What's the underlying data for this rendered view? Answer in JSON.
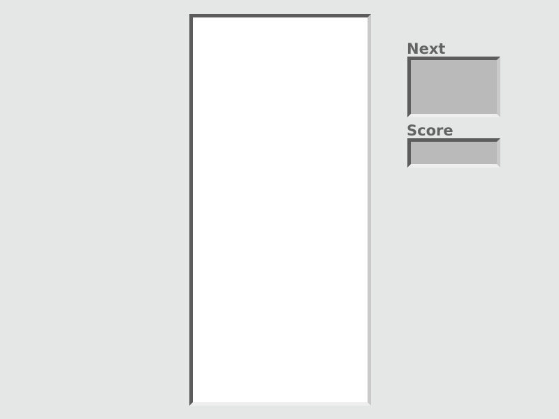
{
  "game": {
    "panels": {
      "next_label": "Next",
      "score_label": "Score",
      "score_value": ""
    },
    "colors": {
      "background": "#e5e6e6",
      "board": "#ffffff",
      "panel_fill": "#bababa",
      "label_text": "#636363",
      "bevel_dark": "#5c5c5c",
      "bevel_light": "#eeeeee"
    }
  }
}
